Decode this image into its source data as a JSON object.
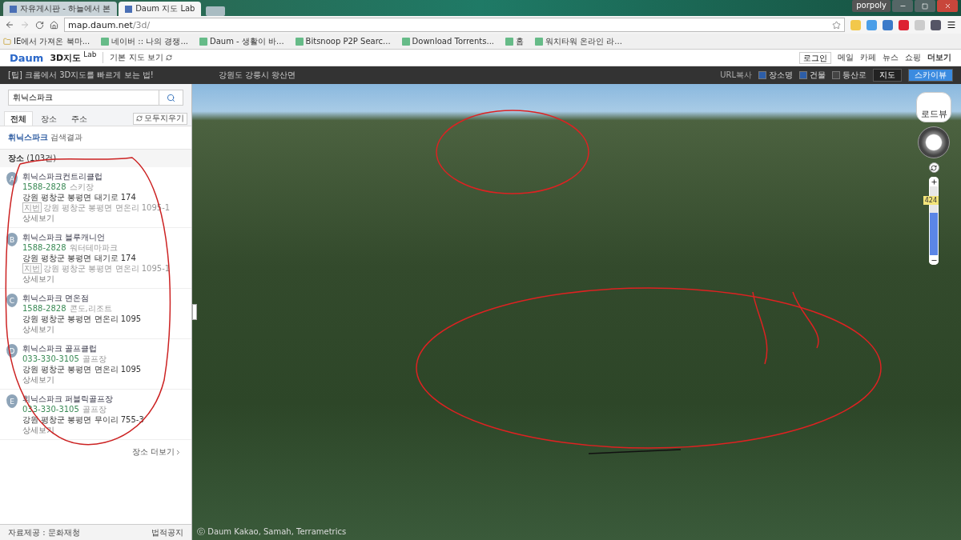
{
  "browser": {
    "tabs": [
      {
        "title": "자유게시판 - 하늘에서 본",
        "selected": false
      },
      {
        "title": "Daum 지도 Lab",
        "selected": true
      }
    ],
    "user": "porpoly",
    "url_host": "map.daum.net",
    "url_path": "/3d/",
    "bookmarks": [
      "IE에서 가져온 북마...",
      "네이버 :: 나의 경쟁...",
      "Daum - 생활이 바...",
      "Bitsnoop P2P Searc...",
      "Download Torrents...",
      "홈",
      "워치타워 온라인 라..."
    ]
  },
  "header": {
    "logo": "Daum",
    "product": "3D지도",
    "badge": "Lab",
    "basic_map_link": "기본 지도 보기",
    "login": "로그인",
    "links": [
      "메일",
      "카페",
      "뉴스",
      "쇼핑",
      "더보기"
    ]
  },
  "infobar": {
    "tip": "[팁] 크롬에서 3D지도를 빠르게 보는 법!",
    "location": "강원도 강릉시 왕산면",
    "url_copy": "URL복사",
    "toggles": [
      {
        "label": "장소명",
        "checked": true
      },
      {
        "label": "건물",
        "checked": true
      },
      {
        "label": "등산로",
        "checked": false
      }
    ],
    "view_buttons": [
      {
        "label": "지도",
        "selected": false
      },
      {
        "label": "스카이뷰",
        "selected": true
      }
    ]
  },
  "sidebar": {
    "search": {
      "value": "휘닉스파크"
    },
    "tabs": [
      {
        "label": "전체",
        "selected": true
      },
      {
        "label": "장소",
        "selected": false
      },
      {
        "label": "주소",
        "selected": false
      }
    ],
    "clear_button": "모두지우기",
    "result_title": "휘닉스파크",
    "result_suffix": "검색결과",
    "section": "장소",
    "count": "(103건)",
    "results": [
      {
        "marker": "A",
        "name": "휘닉스파크컨트리클럽",
        "phone": "1588-2828",
        "category": "스키장",
        "address": "강원 평창군 봉평면 태기로 174",
        "old_tag": "지번",
        "old_address": "강원 평창군 봉평면 면온리 1095-1",
        "detail": "상세보기"
      },
      {
        "marker": "B",
        "name": "휘닉스파크 블루캐니언",
        "phone": "1588-2828",
        "category": "워터테마파크",
        "address": "강원 평창군 봉평면 태기로 174",
        "old_tag": "지번",
        "old_address": "강원 평창군 봉평면 면온리 1095-1",
        "detail": "상세보기"
      },
      {
        "marker": "C",
        "name": "휘닉스파크 면온점",
        "phone": "1588-2828",
        "category": "콘도,리조트",
        "address": "강원 평창군 봉평면 면온리 1095",
        "detail": "상세보기"
      },
      {
        "marker": "D",
        "name": "휘닉스파크 골프클럽",
        "phone": "033-330-3105",
        "category": "골프장",
        "address": "강원 평창군 봉평면 면온리 1095",
        "detail": "상세보기"
      },
      {
        "marker": "E",
        "name": "휘닉스파크 퍼블릭골프장",
        "phone": "033-330-3105",
        "category": "골프장",
        "address": "강원 평창군 봉평면 무이리 755-3",
        "detail": "상세보기"
      }
    ],
    "more": "장소 더보기",
    "footer_left": "자료제공 : 문화재청",
    "footer_right": "법적공지"
  },
  "map": {
    "compass_label": "로드뷰",
    "zoom_badge": "424",
    "zoom": {
      "level": 0.62
    },
    "copyright": "ⓒ Daum Kakao, Samah, Terrametrics"
  }
}
